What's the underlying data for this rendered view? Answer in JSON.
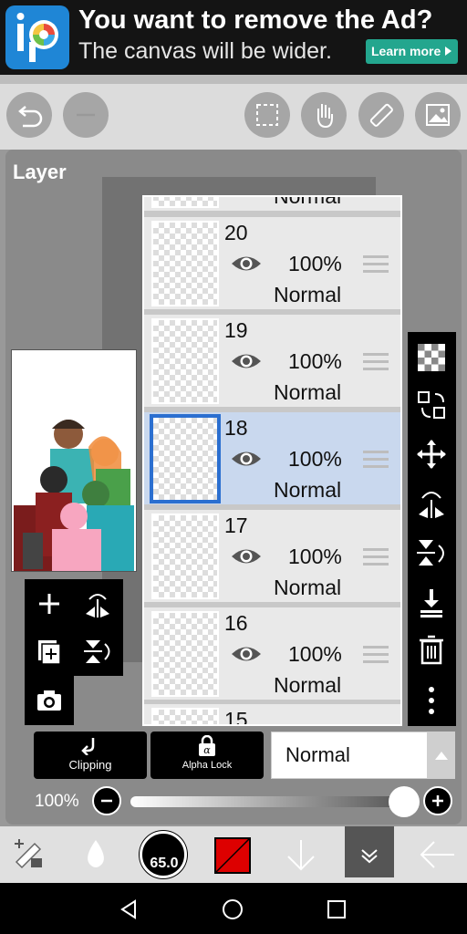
{
  "ad": {
    "title": "You want to remove the Ad?",
    "subtitle": "The canvas will be wider.",
    "button": "Learn more"
  },
  "toolbar": {
    "buttons": [
      "undo-icon",
      "redo-icon",
      "selection-icon",
      "hand-icon",
      "ruler-icon",
      "image-icon"
    ]
  },
  "layer_panel": {
    "title": "Layer",
    "partial_top_mode": "Normal",
    "layers": [
      {
        "number": "20",
        "opacity": "100%",
        "mode": "Normal",
        "selected": false
      },
      {
        "number": "19",
        "opacity": "100%",
        "mode": "Normal",
        "selected": false
      },
      {
        "number": "18",
        "opacity": "100%",
        "mode": "Normal",
        "selected": true
      },
      {
        "number": "17",
        "opacity": "100%",
        "mode": "Normal",
        "selected": false
      },
      {
        "number": "16",
        "opacity": "100%",
        "mode": "Normal",
        "selected": false
      }
    ],
    "partial_bottom_number": "15"
  },
  "bottom_controls": {
    "clipping_label": "Clipping",
    "alpha_lock_label": "Alpha Lock",
    "blend_mode": "Normal",
    "opacity_label": "100%",
    "opacity_value": 100
  },
  "bottom_toolbar": {
    "brush_size": "65.0",
    "primary_color": "#dd0000"
  }
}
